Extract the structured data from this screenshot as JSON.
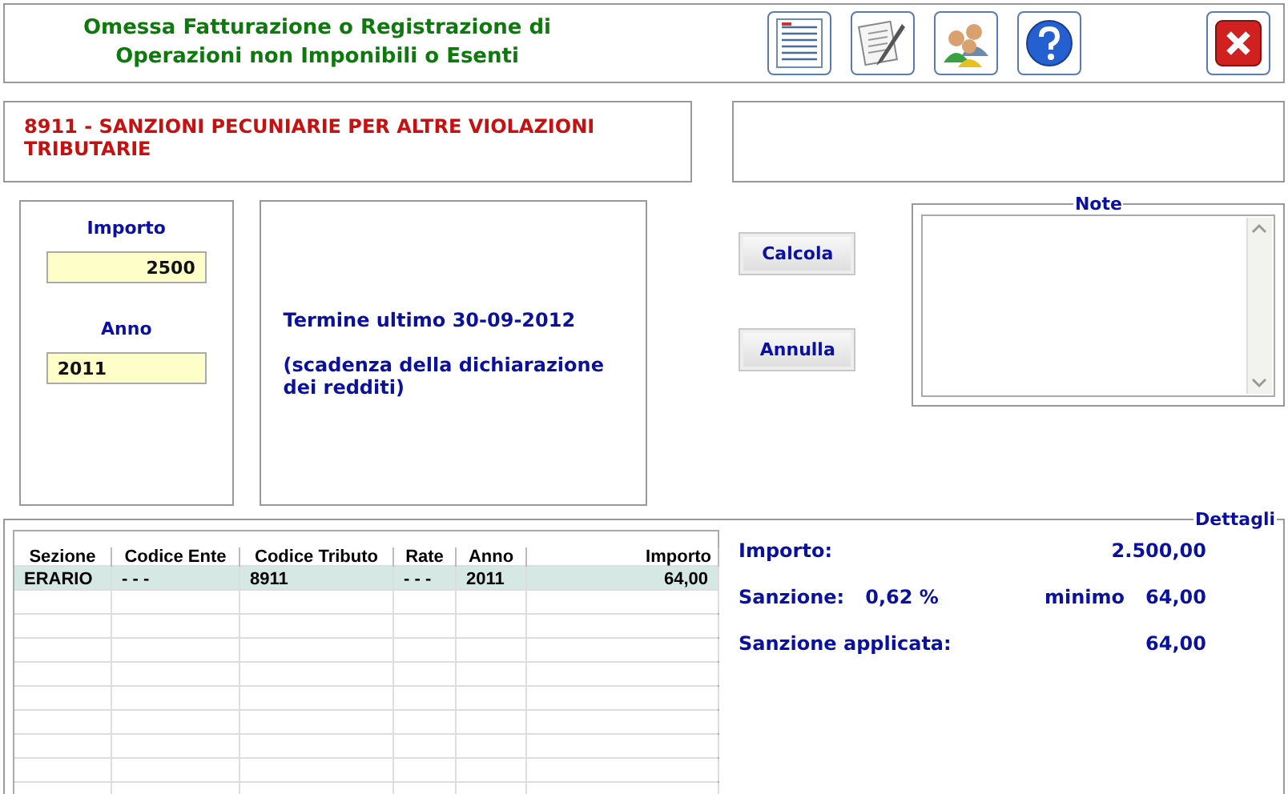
{
  "header": {
    "title": "Omessa Fatturazione o Registrazione di\nOperazioni non Imponibili o Esenti",
    "tools": [
      {
        "kind": "form"
      },
      {
        "kind": "edit"
      },
      {
        "kind": "users"
      },
      {
        "kind": "help"
      }
    ],
    "close": {
      "kind": "close"
    }
  },
  "code_box": {
    "text": "8911 - SANZIONI PECUNIARIE PER ALTRE VIOLAZIONI TRIBUTARIE"
  },
  "inputs": [
    {
      "label": "Importo",
      "value": "2500"
    },
    {
      "label": "Anno",
      "value": "2011"
    }
  ],
  "deadline": {
    "text": "Termine ultimo 30-09-2012",
    "note": "(scadenza della dichiarazione dei redditi)"
  },
  "buttons": [
    "Calcola",
    "Annulla"
  ],
  "note": {
    "legend": "Note"
  },
  "table": {
    "columns": [
      "Sezione",
      "Codice Ente",
      "Codice Tributo",
      "Rate",
      "Anno",
      "Importo"
    ],
    "rows": [
      {
        "cells": [
          "ERARIO",
          "- - -",
          "8911",
          "- - -",
          "2011",
          "64,00"
        ],
        "selected": true
      }
    ]
  },
  "details": {
    "legend": "Dettagli",
    "importo_label": "Importo:",
    "importo_value": "2.500,00",
    "sanzione_label": "Sanzione:",
    "sanzione_rate": "0,62 %",
    "minimo_label": "minimo",
    "minimo_value": "64,00",
    "applicata_label": "Sanzione applicata:",
    "applicata_value": "64,00"
  }
}
